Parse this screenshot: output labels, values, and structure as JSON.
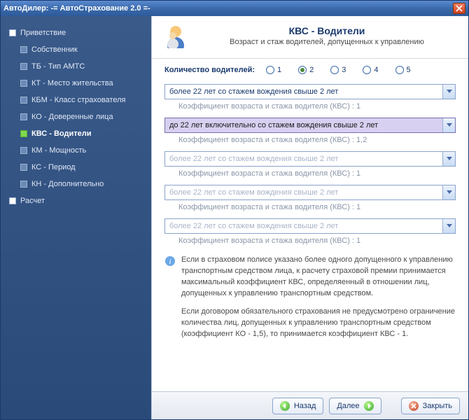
{
  "window": {
    "title": "АвтоДилер:  -= АвтоСтрахование 2.0 =-"
  },
  "sidebar": {
    "items": [
      {
        "label": "Приветствие"
      },
      {
        "label": "Собственник"
      },
      {
        "label": "ТБ - Тип АМТС"
      },
      {
        "label": "КТ - Место жительства"
      },
      {
        "label": "КБМ - Класс страхователя"
      },
      {
        "label": "КО - Доверенные лица"
      },
      {
        "label": "КВС - Водители"
      },
      {
        "label": "КМ - Мощность"
      },
      {
        "label": "КС - Период"
      },
      {
        "label": "КН - Дополнительно"
      },
      {
        "label": "Расчет"
      }
    ]
  },
  "header": {
    "title": "КВС - Водители",
    "subtitle": "Возраст и стаж водителей, допущенных к управлению"
  },
  "count": {
    "label": "Количество водителей:",
    "options": [
      "1",
      "2",
      "3",
      "4",
      "5"
    ],
    "selected": "2"
  },
  "drivers": [
    {
      "value": "более 22 лет со стажем вождения свыше 2 лет",
      "coef": "1",
      "enabled": true,
      "highlight": false
    },
    {
      "value": "до 22 лет включительно со стажем вождения свыше 2 лет",
      "coef": "1,2",
      "enabled": true,
      "highlight": true
    },
    {
      "value": "более 22 лет со стажем вождения свыше 2 лет",
      "coef": "1",
      "enabled": false,
      "highlight": false
    },
    {
      "value": "более 22 лет со стажем вождения свыше 2 лет",
      "coef": "1",
      "enabled": false,
      "highlight": false
    },
    {
      "value": "более 22 лет со стажем вождения свыше 2 лет",
      "coef": "1",
      "enabled": false,
      "highlight": false
    }
  ],
  "coef_label": "Коэффициент возраста и стажа водителя (КВС) :  ",
  "info": {
    "p1": "Если в страховом полисе указано более одного допущенного к управлению транспортным средством лица, к расчету страховой премии принимается максимальный коэффициент КВС, определяенный в отношении лиц, допущенных к управлению транспортным средством.",
    "p2": "Если договором обязательного страхования не предусмотрено ограничение количества лиц, допущенных к управлению транспортным средством (коэффициент КО - 1,5), то принимается коэффициент КВС - 1."
  },
  "footer": {
    "back": "Назад",
    "next": "Далее",
    "close": "Закрыть"
  }
}
